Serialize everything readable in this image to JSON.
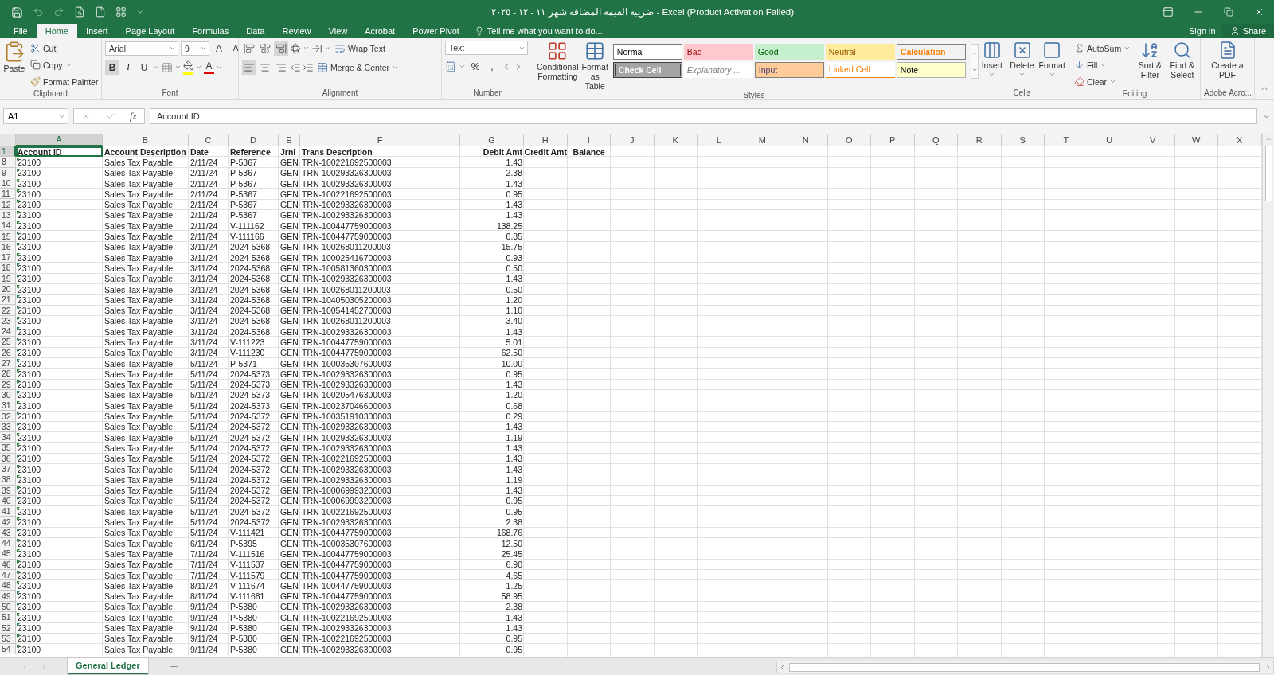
{
  "title_bar": {
    "title": "ضريبه القيمه المضافه شهر ١١ - ١٢ - ٢٠٢٥ - Excel (Product Activation Failed)"
  },
  "ribbon_tabs": [
    {
      "label": "File",
      "selected": false
    },
    {
      "label": "Home",
      "selected": true
    },
    {
      "label": "Insert",
      "selected": false
    },
    {
      "label": "Page Layout",
      "selected": false
    },
    {
      "label": "Formulas",
      "selected": false
    },
    {
      "label": "Data",
      "selected": false
    },
    {
      "label": "Review",
      "selected": false
    },
    {
      "label": "View",
      "selected": false
    },
    {
      "label": "Acrobat",
      "selected": false
    },
    {
      "label": "Power Pivot",
      "selected": false
    }
  ],
  "tell_me": "Tell me what you want to do...",
  "account": {
    "sign_in": "Sign in",
    "share": "Share"
  },
  "clipboard": {
    "paste": "Paste",
    "cut": "Cut",
    "copy": "Copy",
    "format_painter": "Format Painter",
    "label": "Clipboard"
  },
  "font": {
    "name": "Arial",
    "size": "9",
    "grow": "A",
    "shrink": "A",
    "bold": "B",
    "italic": "I",
    "underline": "U",
    "font_color": "A",
    "label": "Font"
  },
  "alignment": {
    "wrap_text": "Wrap Text",
    "merge_center": "Merge & Center",
    "label": "Alignment"
  },
  "number": {
    "format": "Text",
    "percent": "%",
    "comma": ",",
    "label": "Number"
  },
  "styles": {
    "conditional_formatting": "Conditional Formatting",
    "format_as_table": "Format as Table",
    "label": "Styles",
    "cell_styles": [
      {
        "label": "Normal",
        "kind": "normal"
      },
      {
        "label": "Bad",
        "kind": "bad"
      },
      {
        "label": "Good",
        "kind": "good"
      },
      {
        "label": "Neutral",
        "kind": "neutral"
      },
      {
        "label": "Calculation",
        "kind": "calculation"
      },
      {
        "label": "Check Cell",
        "kind": "check"
      },
      {
        "label": "Explanatory ...",
        "kind": "explanatory"
      },
      {
        "label": "Input",
        "kind": "input"
      },
      {
        "label": "Linked Cell",
        "kind": "linked"
      },
      {
        "label": "Note",
        "kind": "note"
      }
    ]
  },
  "cells": {
    "buttons": [
      "Insert",
      "Delete",
      "Format"
    ],
    "label": "Cells"
  },
  "editing": {
    "autosum": "AutoSum",
    "fill": "Fill",
    "clear": "Clear",
    "sort_filter": "Sort & Filter",
    "find_select": "Find & Select",
    "label": "Editing"
  },
  "adobe": {
    "create_pdf": "Create a PDF",
    "label": "Adobe Acro..."
  },
  "formula_bar": {
    "name_box": "A1",
    "fx": "fx",
    "value": "Account ID"
  },
  "columns": [
    {
      "letter": "A",
      "selected": true
    },
    {
      "letter": "B",
      "selected": false
    },
    {
      "letter": "C",
      "selected": false
    },
    {
      "letter": "D",
      "selected": false
    },
    {
      "letter": "E",
      "selected": false
    },
    {
      "letter": "F",
      "selected": false
    },
    {
      "letter": "G",
      "selected": false
    },
    {
      "letter": "H",
      "selected": false
    },
    {
      "letter": "I",
      "selected": false
    },
    {
      "letter": "J",
      "selected": false
    },
    {
      "letter": "K",
      "selected": false
    },
    {
      "letter": "L",
      "selected": false
    },
    {
      "letter": "M",
      "selected": false
    },
    {
      "letter": "N",
      "selected": false
    },
    {
      "letter": "O",
      "selected": false
    },
    {
      "letter": "P",
      "selected": false
    },
    {
      "letter": "Q",
      "selected": false
    },
    {
      "letter": "R",
      "selected": false
    },
    {
      "letter": "S",
      "selected": false
    },
    {
      "letter": "T",
      "selected": false
    },
    {
      "letter": "U",
      "selected": false
    },
    {
      "letter": "V",
      "selected": false
    },
    {
      "letter": "W",
      "selected": false
    },
    {
      "letter": "X",
      "selected": false
    }
  ],
  "rows": [
    {
      "number": "1",
      "selected": true,
      "kind": "header",
      "cells": [
        "Account ID",
        "Account Description",
        "Date",
        "Reference",
        "Jrnl",
        "Trans Description",
        "Debit Amt",
        "Credit Amt",
        "Balance"
      ]
    },
    {
      "number": "8",
      "selected": false,
      "kind": "data",
      "cells": [
        "23100",
        "Sales Tax Payable",
        "2/11/24",
        "P-5367",
        "GEN",
        "TRN-100221692500003",
        "1.43"
      ]
    },
    {
      "number": "9",
      "selected": false,
      "kind": "data",
      "cells": [
        "23100",
        "Sales Tax Payable",
        "2/11/24",
        "P-5367",
        "GEN",
        "TRN-100293326300003",
        "2.38"
      ]
    },
    {
      "number": "10",
      "selected": false,
      "kind": "data",
      "cells": [
        "23100",
        "Sales Tax Payable",
        "2/11/24",
        "P-5367",
        "GEN",
        "TRN-100293326300003",
        "1.43"
      ]
    },
    {
      "number": "11",
      "selected": false,
      "kind": "data",
      "cells": [
        "23100",
        "Sales Tax Payable",
        "2/11/24",
        "P-5367",
        "GEN",
        "TRN-100221692500003",
        "0.95"
      ]
    },
    {
      "number": "12",
      "selected": false,
      "kind": "data",
      "cells": [
        "23100",
        "Sales Tax Payable",
        "2/11/24",
        "P-5367",
        "GEN",
        "TRN-100293326300003",
        "1.43"
      ]
    },
    {
      "number": "13",
      "selected": false,
      "kind": "data",
      "cells": [
        "23100",
        "Sales Tax Payable",
        "2/11/24",
        "P-5367",
        "GEN",
        "TRN-100293326300003",
        "1.43"
      ]
    },
    {
      "number": "14",
      "selected": false,
      "kind": "data",
      "cells": [
        "23100",
        "Sales Tax Payable",
        "2/11/24",
        "V-111162",
        "GEN",
        "TRN-100447759000003",
        "138.25"
      ]
    },
    {
      "number": "15",
      "selected": false,
      "kind": "data",
      "cells": [
        "23100",
        "Sales Tax Payable",
        "2/11/24",
        "V-111166",
        "GEN",
        "TRN-100447759000003",
        "0.85"
      ]
    },
    {
      "number": "16",
      "selected": false,
      "kind": "data",
      "cells": [
        "23100",
        "Sales Tax Payable",
        "3/11/24",
        "2024-5368",
        "GEN",
        "TRN-100268011200003",
        "15.75"
      ]
    },
    {
      "number": "17",
      "selected": false,
      "kind": "data",
      "cells": [
        "23100",
        "Sales Tax Payable",
        "3/11/24",
        "2024-5368",
        "GEN",
        "TRN-100025416700003",
        "0.93"
      ]
    },
    {
      "number": "18",
      "selected": false,
      "kind": "data",
      "cells": [
        "23100",
        "Sales Tax Payable",
        "3/11/24",
        "2024-5368",
        "GEN",
        "TRN-100581360300003",
        "0.50"
      ]
    },
    {
      "number": "19",
      "selected": false,
      "kind": "data",
      "cells": [
        "23100",
        "Sales Tax Payable",
        "3/11/24",
        "2024-5368",
        "GEN",
        "TRN-100293326300003",
        "1.43"
      ]
    },
    {
      "number": "20",
      "selected": false,
      "kind": "data",
      "cells": [
        "23100",
        "Sales Tax Payable",
        "3/11/24",
        "2024-5368",
        "GEN",
        "TRN-100268011200003",
        "0.50"
      ]
    },
    {
      "number": "21",
      "selected": false,
      "kind": "data",
      "cells": [
        "23100",
        "Sales Tax Payable",
        "3/11/24",
        "2024-5368",
        "GEN",
        "TRN-104050305200003",
        "1.20"
      ]
    },
    {
      "number": "22",
      "selected": false,
      "kind": "data",
      "cells": [
        "23100",
        "Sales Tax Payable",
        "3/11/24",
        "2024-5368",
        "GEN",
        "TRN-100541452700003",
        "1.10"
      ]
    },
    {
      "number": "23",
      "selected": false,
      "kind": "data",
      "cells": [
        "23100",
        "Sales Tax Payable",
        "3/11/24",
        "2024-5368",
        "GEN",
        "TRN-100268011200003",
        "3.40"
      ]
    },
    {
      "number": "24",
      "selected": false,
      "kind": "data",
      "cells": [
        "23100",
        "Sales Tax Payable",
        "3/11/24",
        "2024-5368",
        "GEN",
        "TRN-100293326300003",
        "1.43"
      ]
    },
    {
      "number": "25",
      "selected": false,
      "kind": "data",
      "cells": [
        "23100",
        "Sales Tax Payable",
        "3/11/24",
        "V-111223",
        "GEN",
        "TRN-100447759000003",
        "5.01"
      ]
    },
    {
      "number": "26",
      "selected": false,
      "kind": "data",
      "cells": [
        "23100",
        "Sales Tax Payable",
        "3/11/24",
        "V-111230",
        "GEN",
        "TRN-100447759000003",
        "62.50"
      ]
    },
    {
      "number": "27",
      "selected": false,
      "kind": "data",
      "cells": [
        "23100",
        "Sales Tax Payable",
        "5/11/24",
        "P-5371",
        "GEN",
        "TRN-100035307600003",
        "10.00"
      ]
    },
    {
      "number": "28",
      "selected": false,
      "kind": "data",
      "cells": [
        "23100",
        "Sales Tax Payable",
        "5/11/24",
        "2024-5373",
        "GEN",
        "TRN-100293326300003",
        "0.95"
      ]
    },
    {
      "number": "29",
      "selected": false,
      "kind": "data",
      "cells": [
        "23100",
        "Sales Tax Payable",
        "5/11/24",
        "2024-5373",
        "GEN",
        "TRN-100293326300003",
        "1.43"
      ]
    },
    {
      "number": "30",
      "selected": false,
      "kind": "data",
      "cells": [
        "23100",
        "Sales Tax Payable",
        "5/11/24",
        "2024-5373",
        "GEN",
        "TRN-100205476300003",
        "1.20"
      ]
    },
    {
      "number": "31",
      "selected": false,
      "kind": "data",
      "cells": [
        "23100",
        "Sales Tax Payable",
        "5/11/24",
        "2024-5373",
        "GEN",
        "TRN-100237046600003",
        "0.68"
      ]
    },
    {
      "number": "32",
      "selected": false,
      "kind": "data",
      "cells": [
        "23100",
        "Sales Tax Payable",
        "5/11/24",
        "2024-5372",
        "GEN",
        "TRN-100351910300003",
        "0.29"
      ]
    },
    {
      "number": "33",
      "selected": false,
      "kind": "data",
      "cells": [
        "23100",
        "Sales Tax Payable",
        "5/11/24",
        "2024-5372",
        "GEN",
        "TRN-100293326300003",
        "1.43"
      ]
    },
    {
      "number": "34",
      "selected": false,
      "kind": "data",
      "cells": [
        "23100",
        "Sales Tax Payable",
        "5/11/24",
        "2024-5372",
        "GEN",
        "TRN-100293326300003",
        "1.19"
      ]
    },
    {
      "number": "35",
      "selected": false,
      "kind": "data",
      "cells": [
        "23100",
        "Sales Tax Payable",
        "5/11/24",
        "2024-5372",
        "GEN",
        "TRN-100293326300003",
        "1.43"
      ]
    },
    {
      "number": "36",
      "selected": false,
      "kind": "data",
      "cells": [
        "23100",
        "Sales Tax Payable",
        "5/11/24",
        "2024-5372",
        "GEN",
        "TRN-100221692500003",
        "1.43"
      ]
    },
    {
      "number": "37",
      "selected": false,
      "kind": "data",
      "cells": [
        "23100",
        "Sales Tax Payable",
        "5/11/24",
        "2024-5372",
        "GEN",
        "TRN-100293326300003",
        "1.43"
      ]
    },
    {
      "number": "38",
      "selected": false,
      "kind": "data",
      "cells": [
        "23100",
        "Sales Tax Payable",
        "5/11/24",
        "2024-5372",
        "GEN",
        "TRN-100293326300003",
        "1.19"
      ]
    },
    {
      "number": "39",
      "selected": false,
      "kind": "data",
      "cells": [
        "23100",
        "Sales Tax Payable",
        "5/11/24",
        "2024-5372",
        "GEN",
        "TRN-100069993200003",
        "1.43"
      ]
    },
    {
      "number": "40",
      "selected": false,
      "kind": "data",
      "cells": [
        "23100",
        "Sales Tax Payable",
        "5/11/24",
        "2024-5372",
        "GEN",
        "TRN-100069993200003",
        "0.95"
      ]
    },
    {
      "number": "41",
      "selected": false,
      "kind": "data",
      "cells": [
        "23100",
        "Sales Tax Payable",
        "5/11/24",
        "2024-5372",
        "GEN",
        "TRN-100221692500003",
        "0.95"
      ]
    },
    {
      "number": "42",
      "selected": false,
      "kind": "data",
      "cells": [
        "23100",
        "Sales Tax Payable",
        "5/11/24",
        "2024-5372",
        "GEN",
        "TRN-100293326300003",
        "2.38"
      ]
    },
    {
      "number": "43",
      "selected": false,
      "kind": "data",
      "cells": [
        "23100",
        "Sales Tax Payable",
        "5/11/24",
        "V-111421",
        "GEN",
        "TRN-100447759000003",
        "168.76"
      ]
    },
    {
      "number": "44",
      "selected": false,
      "kind": "data",
      "cells": [
        "23100",
        "Sales Tax Payable",
        "6/11/24",
        "P-5395",
        "GEN",
        "TRN-100035307600003",
        "12.50"
      ]
    },
    {
      "number": "45",
      "selected": false,
      "kind": "data",
      "cells": [
        "23100",
        "Sales Tax Payable",
        "7/11/24",
        "V-111516",
        "GEN",
        "TRN-100447759000003",
        "25.45"
      ]
    },
    {
      "number": "46",
      "selected": false,
      "kind": "data",
      "cells": [
        "23100",
        "Sales Tax Payable",
        "7/11/24",
        "V-111537",
        "GEN",
        "TRN-100447759000003",
        "6.90"
      ]
    },
    {
      "number": "47",
      "selected": false,
      "kind": "data",
      "cells": [
        "23100",
        "Sales Tax Payable",
        "7/11/24",
        "V-111579",
        "GEN",
        "TRN-100447759000003",
        "4.65"
      ]
    },
    {
      "number": "48",
      "selected": false,
      "kind": "data",
      "cells": [
        "23100",
        "Sales Tax Payable",
        "8/11/24",
        "V-111674",
        "GEN",
        "TRN-100447759000003",
        "1.25"
      ]
    },
    {
      "number": "49",
      "selected": false,
      "kind": "data",
      "cells": [
        "23100",
        "Sales Tax Payable",
        "8/11/24",
        "V-111681",
        "GEN",
        "TRN-100447759000003",
        "58.95"
      ]
    },
    {
      "number": "50",
      "selected": false,
      "kind": "data",
      "cells": [
        "23100",
        "Sales Tax Payable",
        "9/11/24",
        "P-5380",
        "GEN",
        "TRN-100293326300003",
        "2.38"
      ]
    },
    {
      "number": "51",
      "selected": false,
      "kind": "data",
      "cells": [
        "23100",
        "Sales Tax Payable",
        "9/11/24",
        "P-5380",
        "GEN",
        "TRN-100221692500003",
        "1.43"
      ]
    },
    {
      "number": "52",
      "selected": false,
      "kind": "data",
      "cells": [
        "23100",
        "Sales Tax Payable",
        "9/11/24",
        "P-5380",
        "GEN",
        "TRN-100293326300003",
        "1.43"
      ]
    },
    {
      "number": "53",
      "selected": false,
      "kind": "data",
      "cells": [
        "23100",
        "Sales Tax Payable",
        "9/11/24",
        "P-5380",
        "GEN",
        "TRN-100221692500003",
        "0.95"
      ]
    },
    {
      "number": "54",
      "selected": false,
      "kind": "data",
      "cells": [
        "23100",
        "Sales Tax Payable",
        "9/11/24",
        "P-5380",
        "GEN",
        "TRN-100293326300003",
        "0.95"
      ]
    }
  ],
  "sheet_tabs": [
    {
      "label": "General Ledger",
      "selected": true
    }
  ]
}
